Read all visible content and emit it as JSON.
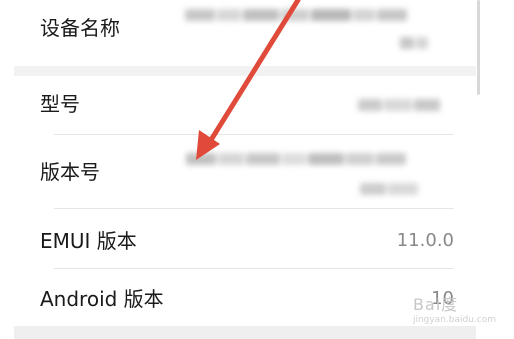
{
  "settings": {
    "rows": [
      {
        "label": "设备名称",
        "value": ""
      },
      {
        "label": "型号",
        "value": ""
      },
      {
        "label": "版本号",
        "value": ""
      },
      {
        "label": "EMUI 版本",
        "value": "11.0.0"
      },
      {
        "label": "Android 版本",
        "value": "10"
      }
    ]
  },
  "watermark": {
    "text": "Bai度",
    "subtext": "jingyan.baidu.com"
  },
  "colors": {
    "annotation_arrow": "#e04a3a",
    "label_text": "#1a1a1a",
    "value_text": "#888888",
    "divider": "#e6e6e6"
  },
  "icons": [
    "red-annotation-arrow"
  ]
}
